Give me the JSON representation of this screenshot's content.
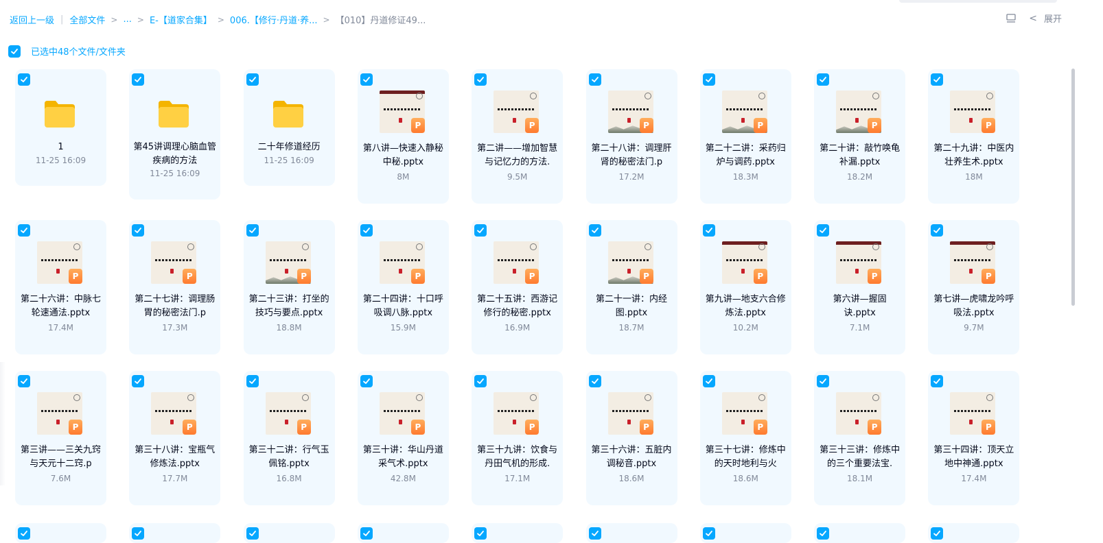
{
  "breadcrumb": {
    "back": "返回上一级",
    "all_files": "全部文件",
    "ellipsis": "...",
    "folder1": "E-【道家合集】",
    "folder2": "006.【修行·丹道·养...",
    "current": "【010】丹道修证49..."
  },
  "toolbar": {
    "expand_label": "展开"
  },
  "selection": {
    "label": "已选中48个文件/文件夹"
  },
  "colors": {
    "accent": "#06a7ff",
    "card_bg": "#f1f9ff",
    "text": "#03081a",
    "muted": "#818999",
    "folder": "#ffc933",
    "ppt": "#ff8a3d"
  },
  "files": [
    {
      "type": "folder",
      "name": "1",
      "meta": "11-25 16:09"
    },
    {
      "type": "folder",
      "name": "第45讲调理心脑血管疾病的方法",
      "meta": "11-25 16:09"
    },
    {
      "type": "folder",
      "name": "二十年修道经历",
      "meta": "11-25 16:09"
    },
    {
      "type": "ppt",
      "name": "第八讲—快速入静秘中秘.pptx",
      "meta": "8M",
      "style": "banner"
    },
    {
      "type": "ppt",
      "name": "第二讲——增加智慧与记忆力的方法.",
      "meta": "9.5M",
      "style": "plain"
    },
    {
      "type": "ppt",
      "name": "第二十八讲：调理肝肾的秘密法门.p",
      "meta": "17.2M",
      "style": "mount"
    },
    {
      "type": "ppt",
      "name": "第二十二讲：采药归炉与调药.pptx",
      "meta": "18.3M",
      "style": "mount"
    },
    {
      "type": "ppt",
      "name": "第二十讲：敲竹唤龟补漏.pptx",
      "meta": "18.2M",
      "style": "mount"
    },
    {
      "type": "ppt",
      "name": "第二十九讲：中医内壮养生术.pptx",
      "meta": "18M",
      "style": "plain"
    },
    {
      "type": "ppt",
      "name": "第二十六讲：中脉七轮速通法.pptx",
      "meta": "17.4M",
      "style": "plain"
    },
    {
      "type": "ppt",
      "name": "第二十七讲：调理肠胃的秘密法门.p",
      "meta": "17.3M",
      "style": "plain"
    },
    {
      "type": "ppt",
      "name": "第二十三讲：打坐的技巧与要点.pptx",
      "meta": "18.8M",
      "style": "mount"
    },
    {
      "type": "ppt",
      "name": "第二十四讲：十口呼吸调八脉.pptx",
      "meta": "15.9M",
      "style": "plain"
    },
    {
      "type": "ppt",
      "name": "第二十五讲：西游记修行的秘密.pptx",
      "meta": "16.9M",
      "style": "plain"
    },
    {
      "type": "ppt",
      "name": "第二十一讲：内经图.pptx",
      "meta": "18.7M",
      "style": "mount"
    },
    {
      "type": "ppt",
      "name": "第九讲—地支六合修炼法.pptx",
      "meta": "10.2M",
      "style": "banner"
    },
    {
      "type": "ppt",
      "name": "第六讲—握固诀.pptx",
      "meta": "7.1M",
      "style": "banner"
    },
    {
      "type": "ppt",
      "name": "第七讲—虎啸龙吟呼吸法.pptx",
      "meta": "9.7M",
      "style": "banner"
    },
    {
      "type": "ppt",
      "name": "第三讲——三关九窍与天元十二窍.p",
      "meta": "7.6M",
      "style": "plain"
    },
    {
      "type": "ppt",
      "name": "第三十八讲：宝瓶气修炼法.pptx",
      "meta": "17.7M",
      "style": "plain"
    },
    {
      "type": "ppt",
      "name": "第三十二讲：行气玉佩铭.pptx",
      "meta": "16.8M",
      "style": "plain"
    },
    {
      "type": "ppt",
      "name": "第三十讲：华山丹道采气术.pptx",
      "meta": "42.8M",
      "style": "plain"
    },
    {
      "type": "ppt",
      "name": "第三十九讲：饮食与丹田气机的形成.",
      "meta": "17.1M",
      "style": "plain"
    },
    {
      "type": "ppt",
      "name": "第三十六讲：五脏内调秘音.pptx",
      "meta": "18.6M",
      "style": "plain"
    },
    {
      "type": "ppt",
      "name": "第三十七讲：修炼中的天时地利与火",
      "meta": "18.6M",
      "style": "plain"
    },
    {
      "type": "ppt",
      "name": "第三十三讲：修炼中的三个重要法宝.",
      "meta": "18.1M",
      "style": "plain"
    },
    {
      "type": "ppt",
      "name": "第三十四讲：顶天立地中神通.pptx",
      "meta": "17.4M",
      "style": "plain"
    }
  ]
}
